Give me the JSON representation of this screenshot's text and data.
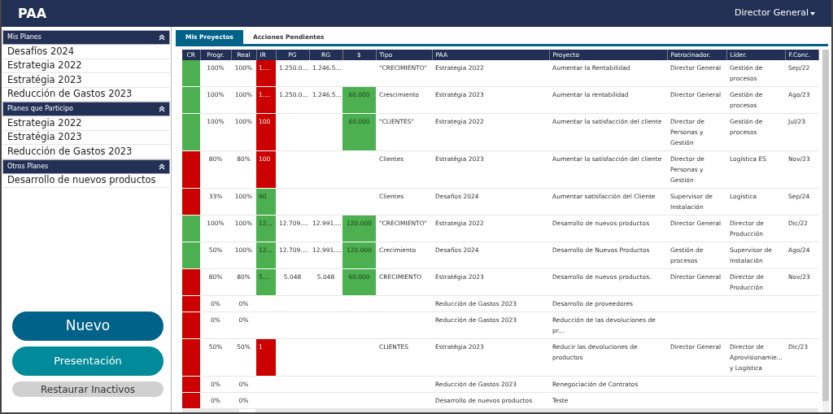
{
  "app": {
    "title": "PAA",
    "user_menu": "Director General"
  },
  "sidebar": {
    "sections": [
      {
        "title": "Mis Planes",
        "expanded": true,
        "items": [
          "Desafíos 2024",
          "Estrategia 2022",
          "Estratégia 2023",
          "Reducción de Gastos 2023"
        ]
      },
      {
        "title": "Planes que Participo",
        "expanded": true,
        "items": [
          "Estrategia 2022",
          "Estratégia 2023",
          "Reducción de Gastos 2023"
        ]
      },
      {
        "title": "Otros Planes",
        "expanded": true,
        "items": [
          "Desarrollo de nuevos productos"
        ]
      }
    ],
    "buttons": [
      {
        "label": "Nuevo",
        "kind": "primary"
      },
      {
        "label": "Presentación",
        "kind": "secondary"
      },
      {
        "label": "Restaurar Inactivos",
        "kind": "muted"
      }
    ]
  },
  "tabs": [
    {
      "label": "Mis Proyectos",
      "selected": true
    },
    {
      "label": "Acciones Pendientes",
      "selected": false
    }
  ],
  "table": {
    "columns": [
      "CR",
      "Progr.",
      "Real",
      "IR",
      "PG",
      "RG",
      "$",
      "Tipo",
      "PAA",
      "Proyecto",
      "Patrocinador.",
      "Líder.",
      "F.Conc."
    ],
    "rows": [
      {
        "cr": {
          "color": "#4caf50"
        },
        "progr": "100%",
        "real": "100%",
        "ir": {
          "text": "1....",
          "color": "#cc0000"
        },
        "pg": "1.250.0...",
        "rg": "1.246.5...",
        "money": null,
        "tipo": "\"CRECIMIENTO\"",
        "paa": "Estrategia 2022",
        "proyecto": "Aumentar la Rentabilidad",
        "patrocinador": "Director General",
        "lider": "Gestión de procesos",
        "fconc": "Sep/22"
      },
      {
        "cr": {
          "color": "#4caf50"
        },
        "progr": "100%",
        "real": "100%",
        "ir": {
          "text": "1....",
          "color": "#cc0000"
        },
        "pg": "1.250.0...",
        "rg": "1.246.5...",
        "money": {
          "text": "60.000",
          "color": "#4caf50"
        },
        "tipo": "Crescimiento",
        "paa": "Estratégia 2023",
        "proyecto": "Aumentar la rentabilidad",
        "patrocinador": "Director General",
        "lider": "Gestión de procesos",
        "fconc": "Ago/23"
      },
      {
        "cr": {
          "color": "#4caf50"
        },
        "progr": "100%",
        "real": "100%",
        "ir": {
          "text": "100",
          "color": "#cc0000"
        },
        "pg": "",
        "rg": "",
        "money": {
          "text": "60.000",
          "color": "#4caf50"
        },
        "tipo": "\"CLIENTES\"",
        "paa": "Estrategia 2022",
        "proyecto": "Aumentar la satisfacción del cliente",
        "patrocinador": "Director de Personas y Gestión",
        "lider": "Gestión de procesos",
        "fconc": "Jul/23"
      },
      {
        "cr": {
          "color": "#cc0000"
        },
        "progr": "80%",
        "real": "80%",
        "ir": {
          "text": "100",
          "color": "#cc0000"
        },
        "pg": "",
        "rg": "",
        "money": null,
        "tipo": "Clientes",
        "paa": "Estratégia 2023",
        "proyecto": "Aumentar la satisfacción del cliente",
        "patrocinador": "Director de Personas y Gestión",
        "lider": "Logística ES",
        "fconc": "Nov/23"
      },
      {
        "cr": {
          "color": "#cc0000"
        },
        "progr": "33%",
        "real": "100%",
        "ir": {
          "text": "90",
          "color": "#4caf50"
        },
        "pg": "",
        "rg": "",
        "money": null,
        "tipo": "Clientes",
        "paa": "Desafíos 2024",
        "proyecto": "Aumentar satisfacción del Cliente",
        "patrocinador": "Supervisor de Instalación",
        "lider": "Logística",
        "fconc": "Sep/24"
      },
      {
        "cr": {
          "color": "#4caf50"
        },
        "progr": "100%",
        "real": "100%",
        "ir": {
          "text": "12...",
          "color": "#4caf50"
        },
        "pg": "12.709....",
        "rg": "12.991....",
        "money": {
          "text": "120.000",
          "color": "#4caf50"
        },
        "tipo": "\"CRECIMIENTO\"",
        "paa": "Estrategia 2022",
        "proyecto": "Desarrollo de nuevos productos",
        "patrocinador": "Director General",
        "lider": "Director de Producción",
        "fconc": "Dic/22"
      },
      {
        "cr": {
          "color": "#4caf50"
        },
        "progr": "50%",
        "real": "100%",
        "ir": {
          "text": "12...",
          "color": "#4caf50"
        },
        "pg": "12.709....",
        "rg": "12.991....",
        "money": {
          "text": "120.000",
          "color": "#4caf50"
        },
        "tipo": "Crecimiento",
        "paa": "Desafíos 2024",
        "proyecto": "Desarrollo de Nuevos Productos",
        "patrocinador": "Gestión de procesos",
        "lider": "Supervisor de Instalación",
        "fconc": "Ago/24"
      },
      {
        "cr": {
          "color": "#cc0000"
        },
        "progr": "80%",
        "real": "80%",
        "ir": {
          "text": "5....",
          "color": "#4caf50"
        },
        "pg": "5.048",
        "rg": "5.048",
        "money": {
          "text": "60.000",
          "color": "#4caf50"
        },
        "tipo": "CRECIMIENTO",
        "paa": "Estratégia 2023",
        "proyecto": "Desarrollo de nuevos productos.",
        "patrocinador": "Director General",
        "lider": "Director de Producción",
        "fconc": "Nov/23"
      },
      {
        "cr": {
          "color": "#cc0000"
        },
        "progr": "0%",
        "real": "0%",
        "ir": null,
        "pg": "",
        "rg": "",
        "money": null,
        "tipo": "",
        "paa": "Reducción de Gastos 2023",
        "proyecto": "Desarrollo de proveedores",
        "patrocinador": "",
        "lider": "",
        "fconc": ""
      },
      {
        "cr": {
          "color": "#cc0000"
        },
        "progr": "0%",
        "real": "0%",
        "ir": null,
        "pg": "",
        "rg": "",
        "money": null,
        "tipo": "",
        "paa": "Reducción de Gastos 2023",
        "proyecto": "Reducción de las devoluciones de pr...",
        "patrocinador": "",
        "lider": "",
        "fconc": ""
      },
      {
        "cr": {
          "color": "#cc0000"
        },
        "progr": "50%",
        "real": "50%",
        "ir": {
          "text": "1",
          "color": "#cc0000"
        },
        "pg": "",
        "rg": "",
        "money": null,
        "tipo": "CLIENTES",
        "paa": "Estratégia 2023",
        "proyecto": "Reducir las devoluciones de productos",
        "patrocinador": "Director General",
        "lider": "Director de Aprovisionamie... y Logística",
        "fconc": "Dic/23"
      },
      {
        "cr": {
          "color": "#cc0000"
        },
        "progr": "0%",
        "real": "0%",
        "ir": null,
        "pg": "",
        "rg": "",
        "money": null,
        "tipo": "",
        "paa": "Reducción de Gastos 2023",
        "proyecto": "Renegociación de Contratos",
        "patrocinador": "",
        "lider": "",
        "fconc": ""
      },
      {
        "cr": {
          "color": "#cc0000"
        },
        "progr": "0%",
        "real": "0%",
        "ir": null,
        "pg": "",
        "rg": "",
        "money": null,
        "tipo": "",
        "paa": "Desarrollo de nuevos productos",
        "proyecto": "Teste",
        "patrocinador": "",
        "lider": "",
        "fconc": ""
      }
    ]
  }
}
